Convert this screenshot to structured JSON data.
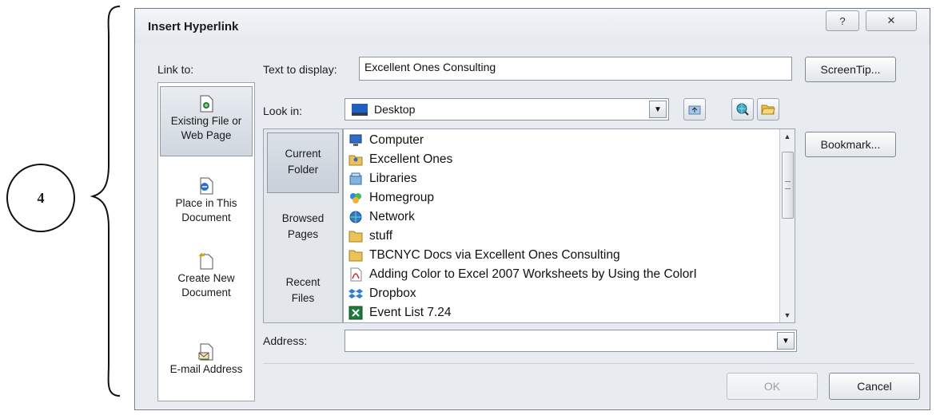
{
  "annotation": {
    "number": "4"
  },
  "dialog": {
    "title": "Insert Hyperlink",
    "help_glyph": "?",
    "close_glyph": "✕",
    "link_to_label": "Link to:",
    "link_to_items": [
      {
        "label_line1": "Existing File or",
        "label_line2": "Web Page",
        "selected": true
      },
      {
        "label_line1": "Place in This",
        "label_line2": "Document",
        "selected": false
      },
      {
        "label_line1": "Create New",
        "label_line2": "Document",
        "selected": false
      },
      {
        "label_line1": "E-mail Address",
        "label_line2": "",
        "selected": false
      }
    ],
    "text_to_display_label": "Text to display:",
    "text_to_display_value": "Excellent Ones Consulting",
    "screentip_label": "ScreenTip...",
    "look_in_label": "Look in:",
    "look_in_value": "Desktop",
    "browse_items": [
      {
        "line1": "Current",
        "line2": "Folder",
        "selected": true
      },
      {
        "line1": "Browsed",
        "line2": "Pages",
        "selected": false
      },
      {
        "line1": "Recent",
        "line2": "Files",
        "selected": false
      }
    ],
    "files": [
      {
        "name": "Computer",
        "icon": "computer-icon"
      },
      {
        "name": "Excellent Ones",
        "icon": "user-folder-icon"
      },
      {
        "name": "Libraries",
        "icon": "libraries-icon"
      },
      {
        "name": "Homegroup",
        "icon": "homegroup-icon"
      },
      {
        "name": "Network",
        "icon": "network-icon"
      },
      {
        "name": "stuff",
        "icon": "folder-icon"
      },
      {
        "name": "TBCNYC Docs via Excellent Ones Consulting",
        "icon": "folder-icon"
      },
      {
        "name": "Adding Color to Excel 2007 Worksheets by Using the ColorI",
        "icon": "pdf-icon"
      },
      {
        "name": "Dropbox",
        "icon": "dropbox-icon"
      },
      {
        "name": "Event List 7.24",
        "icon": "excel-icon"
      }
    ],
    "bookmark_label": "Bookmark...",
    "address_label": "Address:",
    "address_value": "",
    "ok_label": "OK",
    "cancel_label": "Cancel",
    "colors": {
      "dialog_bg": "#e8ebef",
      "border": "#8b96a3",
      "selected": "#cfd6de"
    }
  }
}
